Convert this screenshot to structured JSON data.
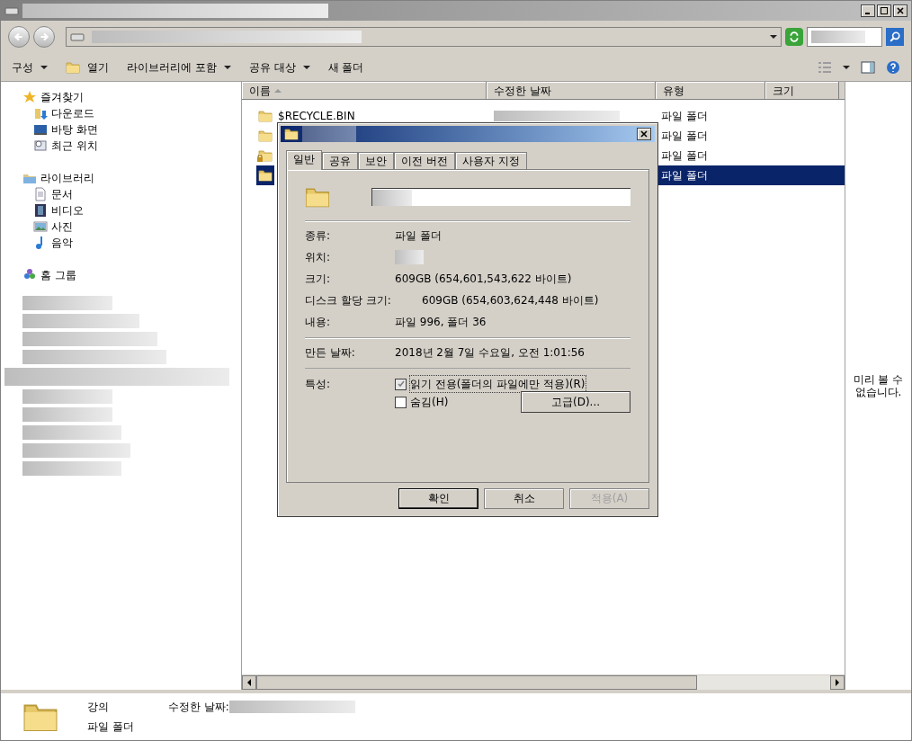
{
  "toolbar": {
    "items": [
      {
        "label": "구성",
        "kind": "menu"
      },
      {
        "label": "열기",
        "kind": "open"
      },
      {
        "label": "라이브러리에 포함",
        "kind": "menu"
      },
      {
        "label": "공유 대상",
        "kind": "menu"
      },
      {
        "label": "새 폴더",
        "kind": "button"
      }
    ]
  },
  "nav": [
    {
      "label": "즐겨찾기",
      "kind": "star",
      "children": [
        {
          "label": "다운로드",
          "kind": "download"
        },
        {
          "label": "바탕 화면",
          "kind": "desktop"
        },
        {
          "label": "최근 위치",
          "kind": "recent"
        }
      ]
    },
    {
      "label": "라이브러리",
      "kind": "library",
      "children": [
        {
          "label": "문서",
          "kind": "document"
        },
        {
          "label": "비디오",
          "kind": "video"
        },
        {
          "label": "사진",
          "kind": "picture"
        },
        {
          "label": "음악",
          "kind": "music"
        }
      ]
    },
    {
      "label": "홈 그룹",
      "kind": "homegroup"
    }
  ],
  "columns": [
    {
      "label": "이름",
      "sorted": true
    },
    {
      "label": "수정한 날짜",
      "sorted": false
    },
    {
      "label": "유형",
      "sorted": false
    },
    {
      "label": "크기",
      "sorted": false
    }
  ],
  "rows": [
    {
      "name": "$RECYCLE.BIN",
      "type": "파일 폴더",
      "locked": false,
      "selected": false
    },
    {
      "type": "파일 폴더",
      "locked": false,
      "selected": false
    },
    {
      "type": "파일 폴더",
      "locked": true,
      "selected": false
    },
    {
      "type": "파일 폴더",
      "locked": false,
      "selected": true
    }
  ],
  "preview": {
    "text": "미리 볼 수 없습니다."
  },
  "details": {
    "name": "강의",
    "date_label": "수정한 날짜:",
    "type": "파일 폴더"
  },
  "dialog": {
    "tabs": [
      {
        "label": "일반",
        "selected": true
      },
      {
        "label": "공유",
        "selected": false
      },
      {
        "label": "보안",
        "selected": false
      },
      {
        "label": "이전 버전",
        "selected": false
      },
      {
        "label": "사용자 지정",
        "selected": false
      }
    ],
    "sections": [
      [
        {
          "label": "종류:",
          "value": "파일 폴더"
        },
        {
          "label": "위치:"
        },
        {
          "label": "크기:",
          "value": "609GB (654,601,543,622 바이트)"
        },
        {
          "label": "디스크 할당 크기:",
          "value": "609GB (654,603,624,448 바이트)"
        },
        {
          "label": "내용:",
          "value": "파일 996, 폴더 36"
        }
      ],
      [
        {
          "label": "만든 날짜:",
          "value": "2018년 2월 7일 수요일, 오전 1:01:56"
        }
      ]
    ],
    "attributes_label": "특성:",
    "attributes": [
      {
        "label": "읽기 전용(폴더의 파일에만 적용)(R)",
        "checked": true
      },
      {
        "label": "숨김(H)",
        "checked": false
      }
    ],
    "advanced_button": "고급(D)...",
    "buttons": [
      {
        "label": "확인",
        "disabled": false
      },
      {
        "label": "취소",
        "disabled": false
      },
      {
        "label": "적용(A)",
        "disabled": true
      }
    ]
  }
}
